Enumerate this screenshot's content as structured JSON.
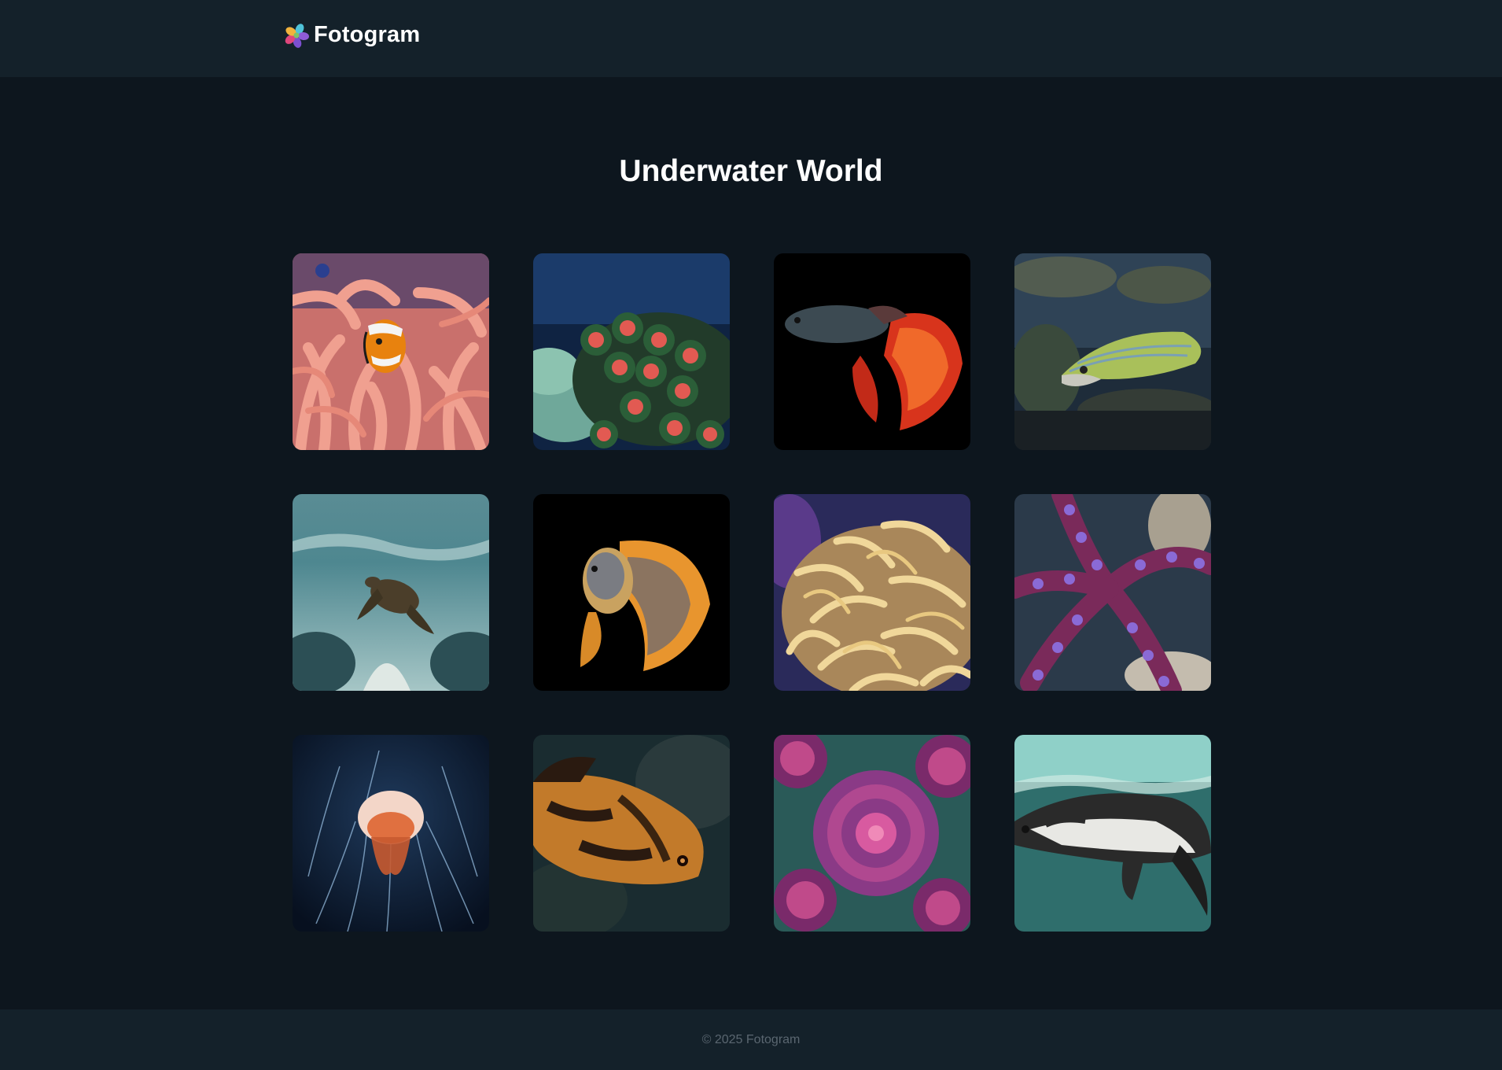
{
  "header": {
    "brand": "Fotogram",
    "logo_icon": "flower-petals-icon",
    "logo_colors": [
      "#f2b33d",
      "#e0467c",
      "#4fc3d9",
      "#8e5bd6",
      "#7cc46a"
    ]
  },
  "page": {
    "title": "Underwater World"
  },
  "gallery": {
    "photos": [
      {
        "subject": "clownfish-in-anemone"
      },
      {
        "subject": "zoanthid-coral"
      },
      {
        "subject": "red-betta-fish"
      },
      {
        "subject": "green-wrasse-fish"
      },
      {
        "subject": "sea-turtle"
      },
      {
        "subject": "orange-betta-fish"
      },
      {
        "subject": "yellow-anemone"
      },
      {
        "subject": "purple-octopus"
      },
      {
        "subject": "jellyfish"
      },
      {
        "subject": "oscar-fish"
      },
      {
        "subject": "pink-coral-polyps"
      },
      {
        "subject": "swimming-penguin"
      }
    ]
  },
  "footer": {
    "copyright": "© 2025 Fotogram"
  },
  "colors": {
    "background": "#0d161e",
    "header_bg": "#14212a",
    "footer_text": "#5a6670"
  }
}
